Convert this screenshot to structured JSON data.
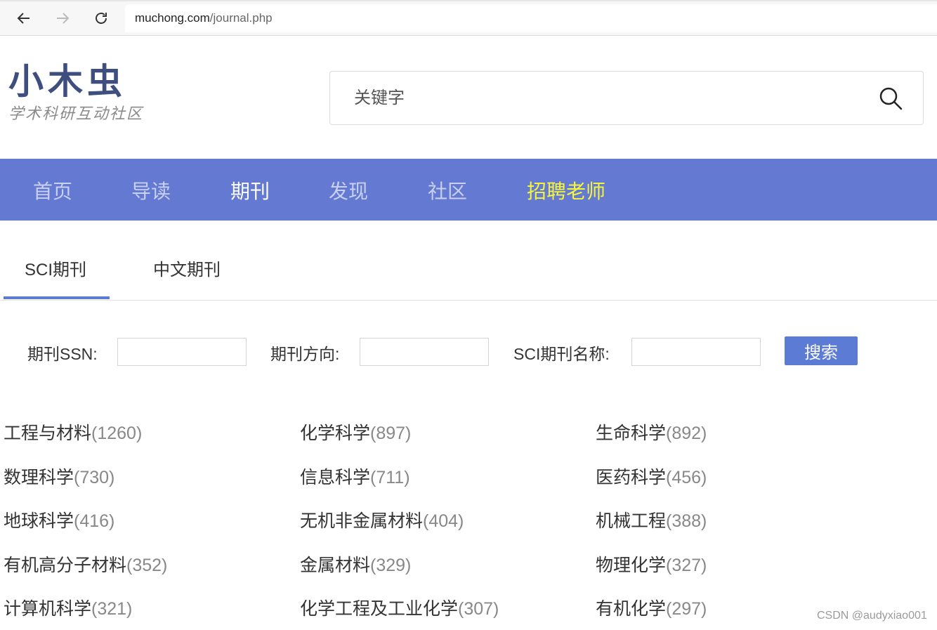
{
  "browser": {
    "url_domain": "muchong.com",
    "url_path": "/journal.php"
  },
  "logo": {
    "title": "小木虫",
    "subtitle": "学术科研互动社区"
  },
  "search": {
    "placeholder": "关键字"
  },
  "main_nav": {
    "items": [
      {
        "label": "首页"
      },
      {
        "label": "导读"
      },
      {
        "label": "期刊"
      },
      {
        "label": "发现"
      },
      {
        "label": "社区"
      },
      {
        "label": "招聘老师"
      }
    ]
  },
  "tabs": [
    {
      "label": "SCI期刊"
    },
    {
      "label": "中文期刊"
    }
  ],
  "filters": {
    "ssn_label": "期刊SSN:",
    "direction_label": "期刊方向:",
    "name_label": "SCI期刊名称:",
    "search_button": "搜索"
  },
  "categories": [
    {
      "name": "工程与材料",
      "count": "(1260)"
    },
    {
      "name": "化学科学",
      "count": "(897)"
    },
    {
      "name": "生命科学",
      "count": "(892)"
    },
    {
      "name": "数理科学",
      "count": "(730)"
    },
    {
      "name": "信息科学",
      "count": "(711)"
    },
    {
      "name": "医药科学",
      "count": "(456)"
    },
    {
      "name": "地球科学",
      "count": "(416)"
    },
    {
      "name": "无机非金属材料",
      "count": "(404)"
    },
    {
      "name": "机械工程",
      "count": "(388)"
    },
    {
      "name": "有机高分子材料",
      "count": "(352)"
    },
    {
      "name": "金属材料",
      "count": "(329)"
    },
    {
      "name": "物理化学",
      "count": "(327)"
    },
    {
      "name": "计算机科学",
      "count": "(321)"
    },
    {
      "name": "化学工程及工业化学",
      "count": "(307)"
    },
    {
      "name": "有机化学",
      "count": "(297)"
    }
  ],
  "watermark": "CSDN @audyxiao001"
}
